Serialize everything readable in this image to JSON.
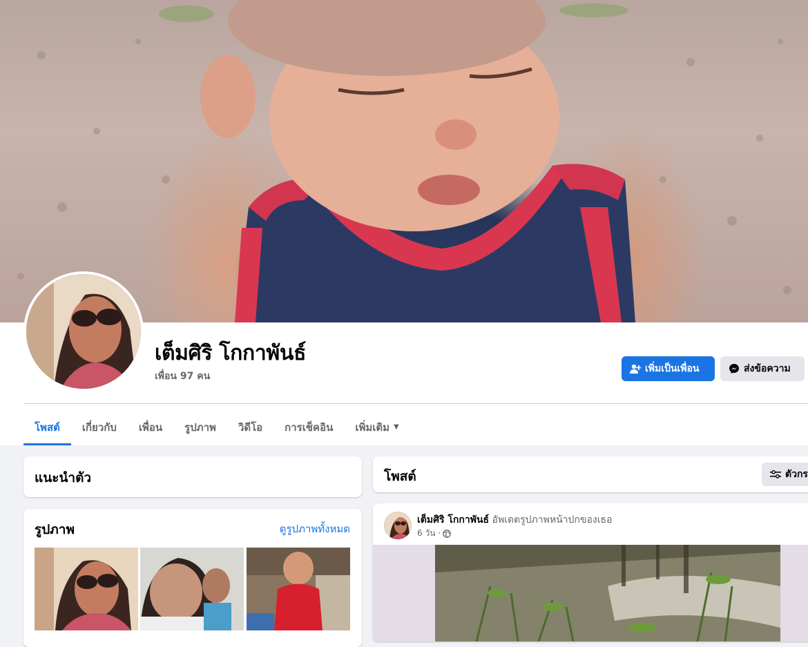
{
  "profile": {
    "name": "เต็มศิริ โกกาพันธ์",
    "friends": "เพื่อน 97 คน"
  },
  "actions": {
    "add_friend": "เพิ่มเป็นเพื่อน",
    "message": "ส่งข้อความ"
  },
  "tabs": [
    {
      "label": "โพสต์",
      "active": true
    },
    {
      "label": "เกี่ยวกับ"
    },
    {
      "label": "เพื่อน"
    },
    {
      "label": "รูปภาพ"
    },
    {
      "label": "วิดีโอ"
    },
    {
      "label": "การเช็คอิน"
    },
    {
      "label": "เพิ่มเติม"
    }
  ],
  "intro": {
    "title": "แนะนำตัว"
  },
  "photos": {
    "title": "รูปภาพ",
    "see_all": "ดูรูปภาพทั้งหมด"
  },
  "posts": {
    "title": "โพสต์",
    "filter_label": "ตัวกร",
    "post": {
      "author": "เต็มศิริ โกกาพันธ์",
      "action": "อัพเดตรูปภาพหน้าปกของเธอ",
      "time": "6 วัน ·"
    }
  },
  "colors": {
    "accent": "#1b74e4",
    "secondary_button": "#e4e6eb",
    "page_bg": "#f0f2f5"
  }
}
